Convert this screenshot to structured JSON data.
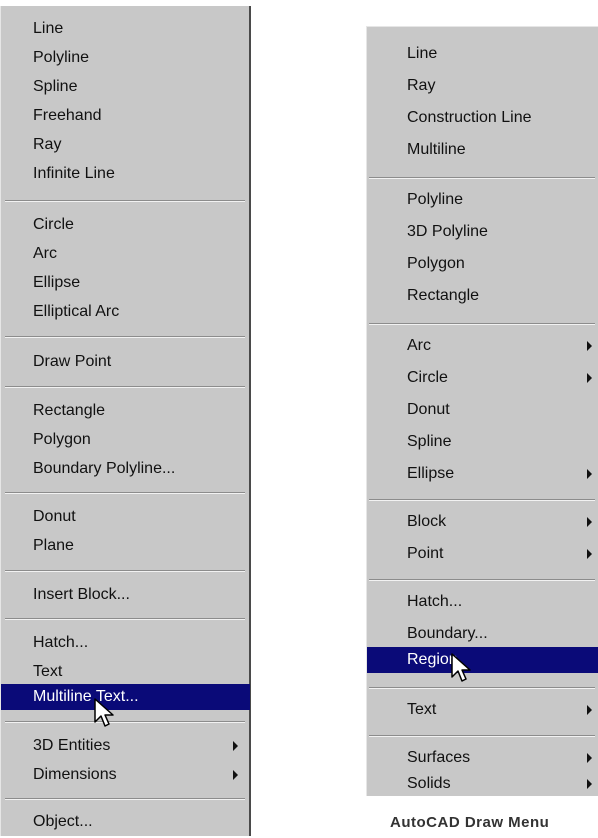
{
  "left_menu": {
    "items": [
      {
        "label": "Line"
      },
      {
        "label": "Polyline"
      },
      {
        "label": "Spline"
      },
      {
        "label": "Freehand"
      },
      {
        "label": "Ray"
      },
      {
        "label": "Infinite Line"
      },
      {
        "label": "Circle"
      },
      {
        "label": "Arc"
      },
      {
        "label": "Ellipse"
      },
      {
        "label": "Elliptical Arc"
      },
      {
        "label": "Draw Point"
      },
      {
        "label": "Rectangle"
      },
      {
        "label": "Polygon"
      },
      {
        "label": "Boundary Polyline..."
      },
      {
        "label": "Donut"
      },
      {
        "label": "Plane"
      },
      {
        "label": "Insert Block..."
      },
      {
        "label": "Hatch..."
      },
      {
        "label": "Text"
      },
      {
        "label": "Multiline Text...",
        "highlighted": true
      },
      {
        "label": "3D Entities",
        "submenu": true
      },
      {
        "label": "Dimensions",
        "submenu": true
      },
      {
        "label": "Object..."
      }
    ]
  },
  "right_menu": {
    "items": [
      {
        "label": "Line"
      },
      {
        "label": "Ray"
      },
      {
        "label": "Construction Line"
      },
      {
        "label": "Multiline"
      },
      {
        "label": "Polyline"
      },
      {
        "label": "3D Polyline"
      },
      {
        "label": "Polygon"
      },
      {
        "label": "Rectangle"
      },
      {
        "label": "Arc",
        "submenu": true
      },
      {
        "label": "Circle",
        "submenu": true
      },
      {
        "label": "Donut"
      },
      {
        "label": "Spline"
      },
      {
        "label": "Ellipse",
        "submenu": true
      },
      {
        "label": "Block",
        "submenu": true
      },
      {
        "label": "Point",
        "submenu": true
      },
      {
        "label": "Hatch..."
      },
      {
        "label": "Boundary..."
      },
      {
        "label": "Region",
        "highlighted": true
      },
      {
        "label": "Text",
        "submenu": true
      },
      {
        "label": "Surfaces",
        "submenu": true
      },
      {
        "label": "Solids",
        "submenu": true
      }
    ]
  },
  "caption": "AutoCAD Draw Menu",
  "colors": {
    "menu_bg": "#c8c8c8",
    "highlight_bg": "#0a0a78",
    "highlight_text": "#ffffff"
  }
}
